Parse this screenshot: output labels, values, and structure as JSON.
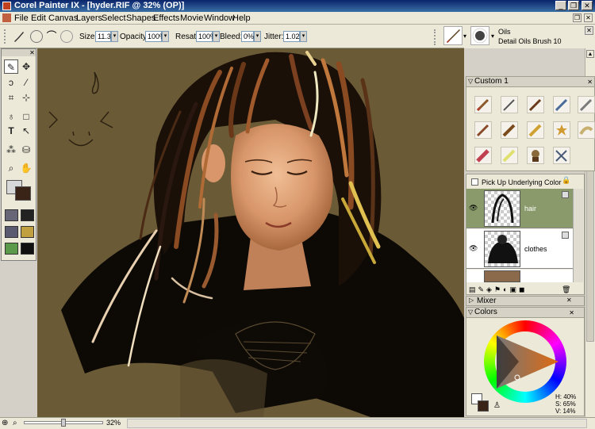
{
  "window": {
    "title": "Corel Painter IX - [hyder.RIF @ 32% (OP)]"
  },
  "menu": [
    "File",
    "Edit",
    "Canvas",
    "Layers",
    "Select",
    "Shapes",
    "Effects",
    "Movie",
    "Window",
    "Help"
  ],
  "propbar": {
    "size_label": "Size:",
    "size_value": "11.3",
    "opacity_label": "Opacity:",
    "opacity_value": "100%",
    "resat_label": "Resat:",
    "resat_value": "100%",
    "bleed_label": "Bleed:",
    "bleed_value": "0%",
    "jitter_label": "Jitter:",
    "jitter_value": "1.02"
  },
  "brush": {
    "category": "Oils",
    "variant": "Detail Oils Brush 10"
  },
  "custom_palette": {
    "title": "Custom 1"
  },
  "layers": {
    "pick_up_label": "Pick Up Underlying Color",
    "items": [
      {
        "name": "hair"
      },
      {
        "name": "clothes"
      }
    ]
  },
  "mixer": {
    "title": "Mixer"
  },
  "colors": {
    "title": "Colors",
    "h": "H: 40%",
    "s": "S: 65%",
    "v": "V: 14%",
    "main_color": "#3a2418",
    "bg_color": "#ffffff"
  },
  "status": {
    "zoom": "32%"
  }
}
